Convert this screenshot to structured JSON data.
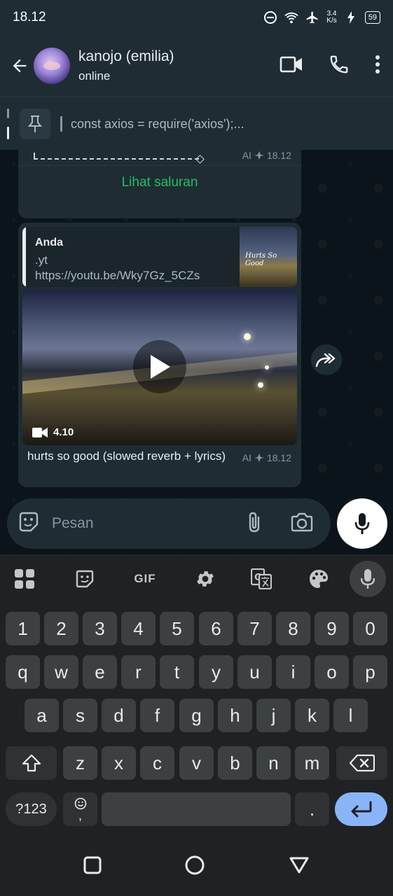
{
  "status_bar": {
    "time": "18.12",
    "net_speed_value": "3.4",
    "net_speed_unit": "K/s",
    "battery": "59"
  },
  "header": {
    "contact_name": "kanojo (emilia)",
    "contact_status": "online"
  },
  "pinned": {
    "text": "const axios = require('axios');..."
  },
  "messages": [
    {
      "type": "channel_preview",
      "ai_label": "AI",
      "time": "18.12",
      "cta_label": "Lihat saluran"
    },
    {
      "type": "video",
      "quote": {
        "sender": "Anda",
        "line1": ".yt",
        "line2": "https://youtu.be/Wky7Gz_5CZs",
        "thumb_text": "Hurts So Good"
      },
      "duration": "4.10",
      "caption": "hurts so good (slowed reverb + lyrics)",
      "ai_label": "AI",
      "time": "18.12"
    }
  ],
  "composer": {
    "placeholder": "Pesan"
  },
  "keyboard": {
    "toolbar": {
      "gif_label": "GIF"
    },
    "rows": [
      [
        "1",
        "2",
        "3",
        "4",
        "5",
        "6",
        "7",
        "8",
        "9",
        "0"
      ],
      [
        "q",
        "w",
        "e",
        "r",
        "t",
        "y",
        "u",
        "i",
        "o",
        "p"
      ],
      [
        "a",
        "s",
        "d",
        "f",
        "g",
        "h",
        "j",
        "k",
        "l"
      ],
      [
        "z",
        "x",
        "c",
        "v",
        "b",
        "n",
        "m"
      ]
    ],
    "symbols_label": "?123",
    "comma": ",",
    "period": "."
  }
}
